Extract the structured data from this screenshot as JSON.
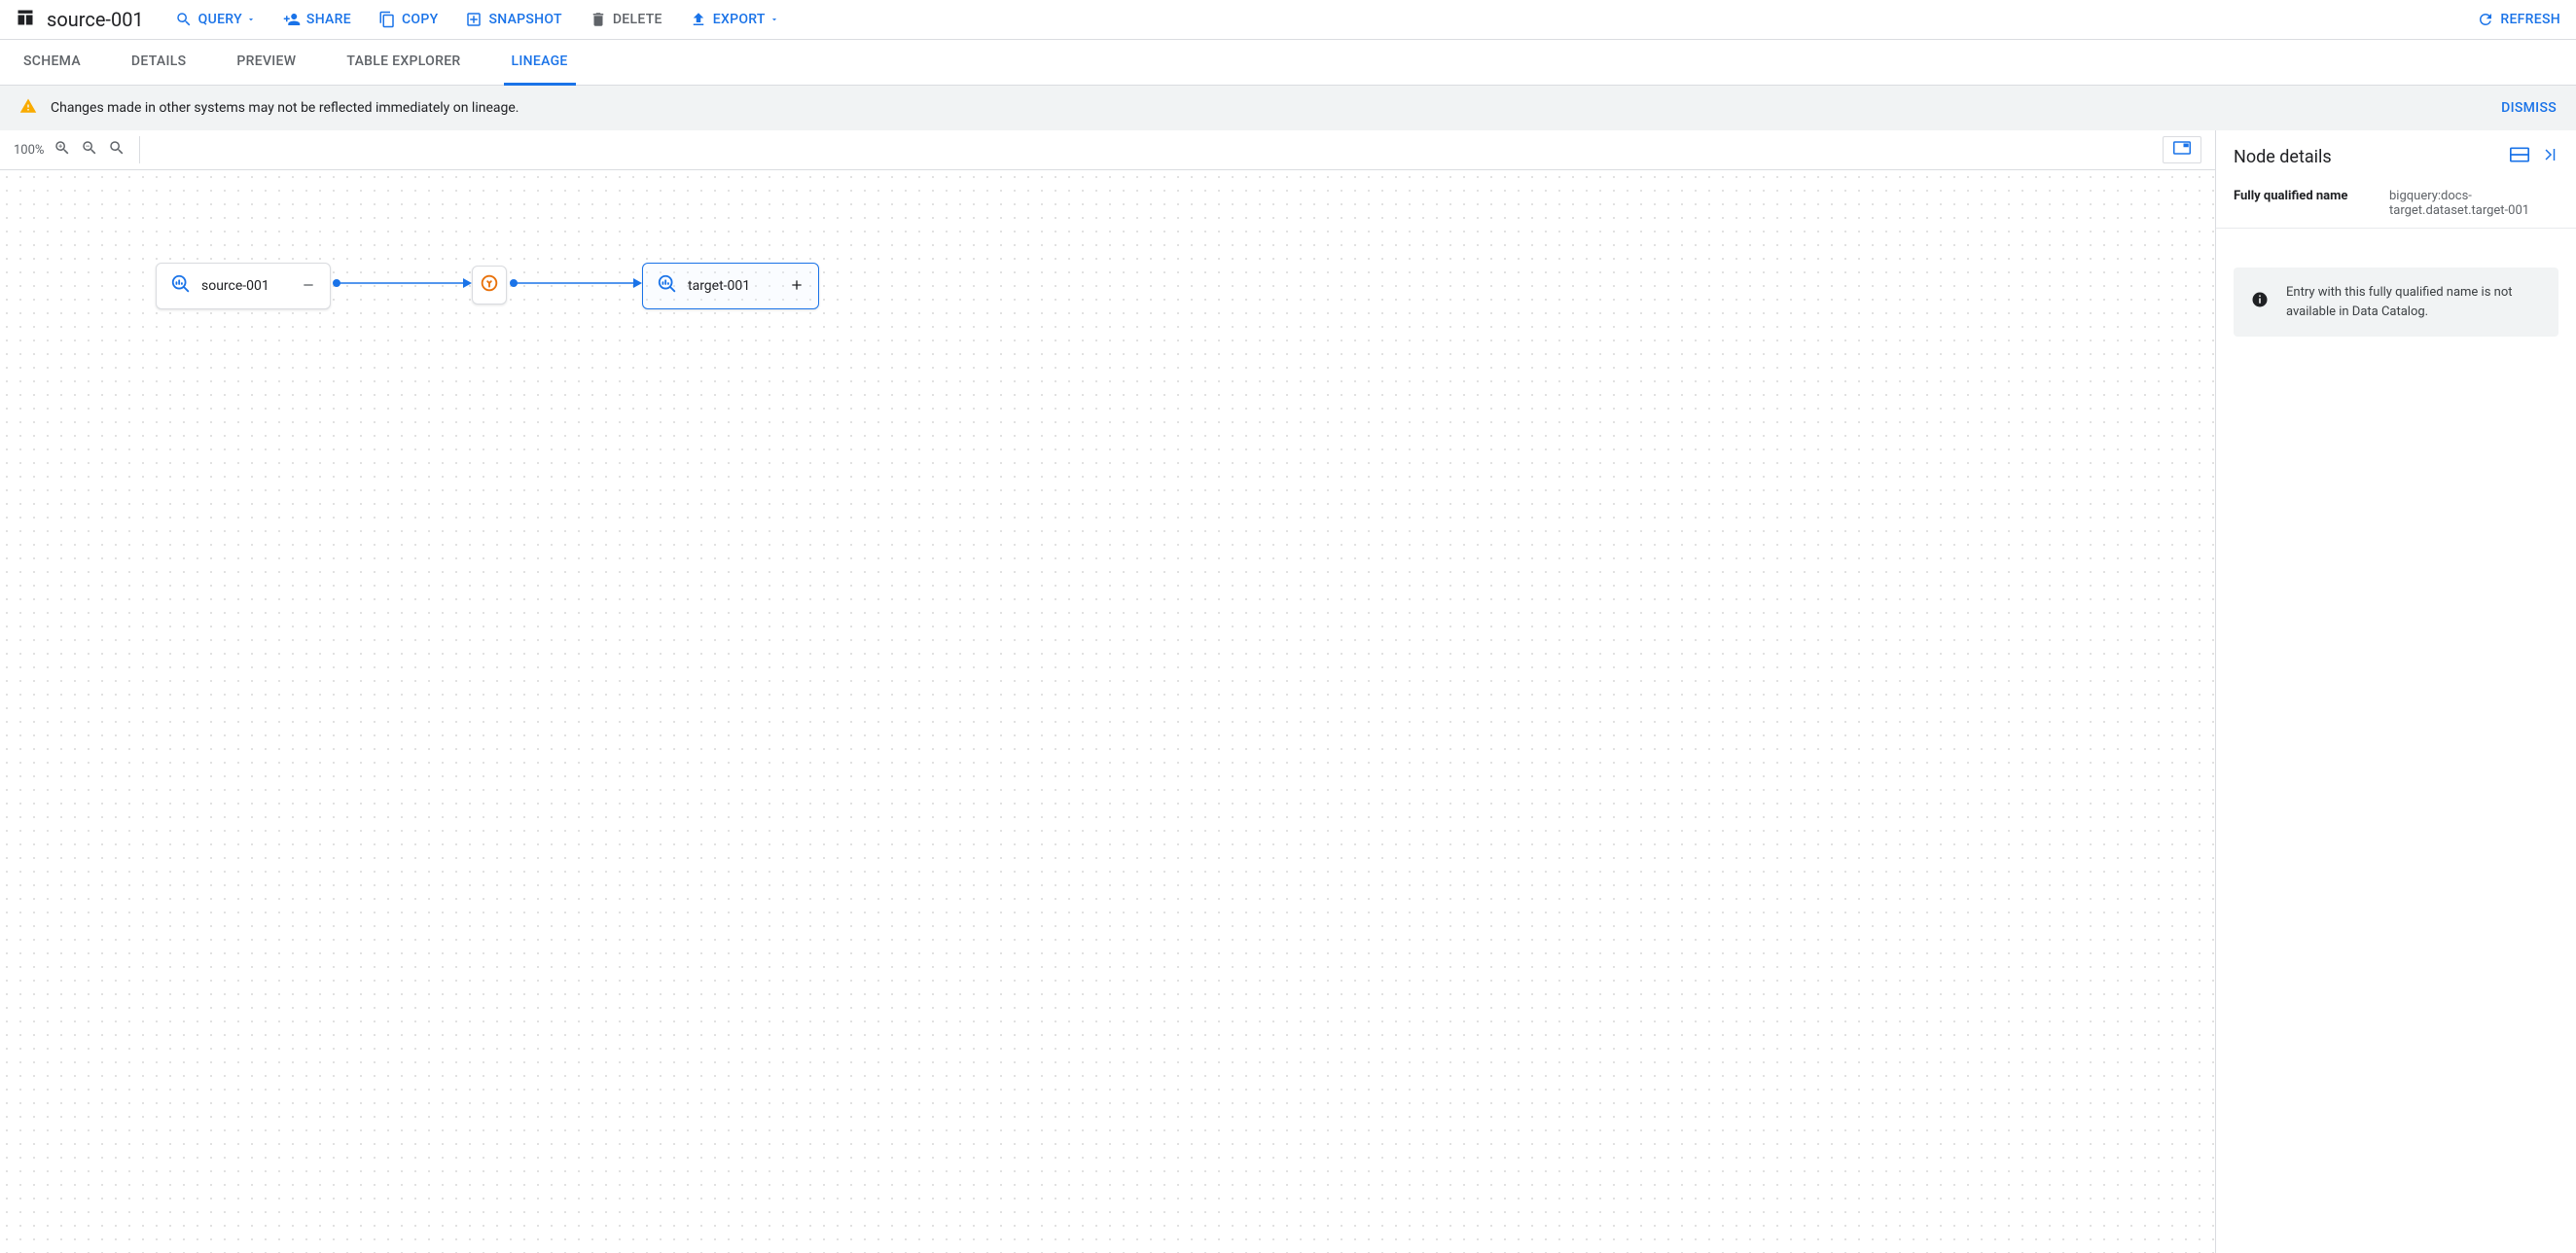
{
  "header": {
    "title": "source-001",
    "actions": {
      "query": "QUERY",
      "share": "SHARE",
      "copy": "COPY",
      "snapshot": "SNAPSHOT",
      "delete": "DELETE",
      "export": "EXPORT",
      "refresh": "REFRESH"
    }
  },
  "tabs": {
    "schema": "SCHEMA",
    "details": "DETAILS",
    "preview": "PREVIEW",
    "table_explorer": "TABLE EXPLORER",
    "lineage": "LINEAGE"
  },
  "banner": {
    "text": "Changes made in other systems may not be reflected immediately on lineage.",
    "dismiss": "DISMISS"
  },
  "canvas_toolbar": {
    "zoom_level": "100%"
  },
  "nodes": {
    "source": {
      "label": "source-001"
    },
    "target": {
      "label": "target-001"
    }
  },
  "details_panel": {
    "title": "Node details",
    "fqn_label": "Fully qualified name",
    "fqn_value": "bigquery:docs-target.dataset.target-001",
    "info_text": "Entry with this fully qualified name is not available in Data Catalog."
  }
}
